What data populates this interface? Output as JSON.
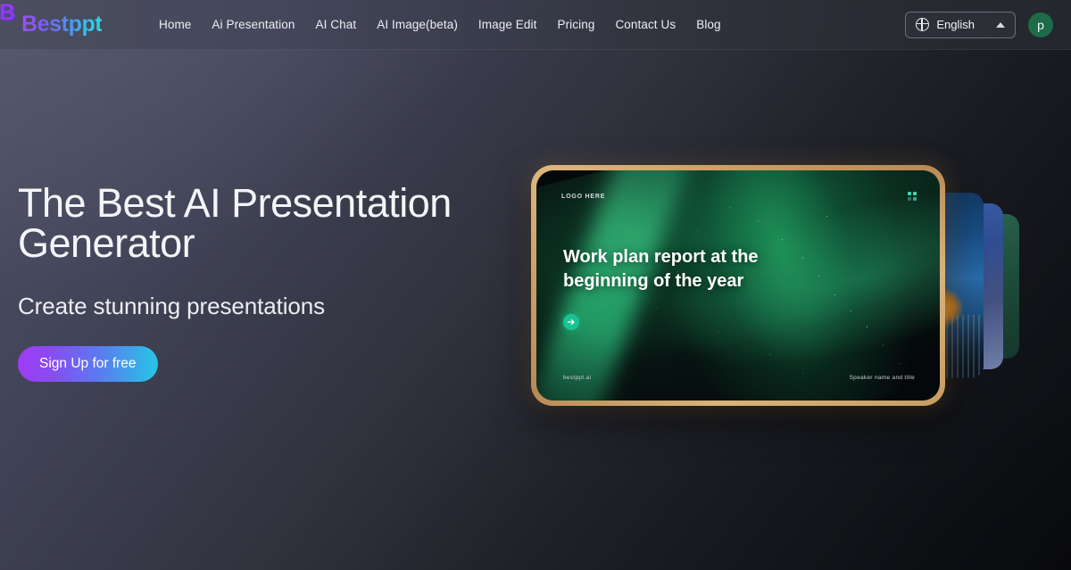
{
  "header": {
    "logo": {
      "full": "Bestppt",
      "first_letter": "B",
      "rest": "estppt"
    },
    "nav": [
      {
        "label": "Home"
      },
      {
        "label": "Ai Presentation"
      },
      {
        "label": "AI Chat"
      },
      {
        "label": "AI Image(beta)"
      },
      {
        "label": "Image Edit"
      },
      {
        "label": "Pricing"
      },
      {
        "label": "Contact Us"
      },
      {
        "label": "Blog"
      }
    ],
    "language": {
      "icon": "globe-icon",
      "value": "English",
      "chevron": "chevron-up-icon"
    },
    "avatar": {
      "initial": "p",
      "color": "#1e6b4a"
    }
  },
  "hero": {
    "title": "The Best AI Presentation\nGenerator",
    "subtitle": "Create stunning presentations",
    "cta_label": "Sign Up for free",
    "cta_gradient_from": "#a13cf5",
    "cta_gradient_to": "#2bbfe6"
  },
  "slide_preview": {
    "logo_placeholder": "LOGO HERE",
    "title": "Work plan report at the\nbeginning of the year",
    "arrow_icon": "arrow-right-icon",
    "footer_left": "bestppt.ai",
    "footer_right": "Speaker name and title",
    "frame_color": "#c99a62",
    "accent_color": "#18c293"
  },
  "stacked_cards": [
    {
      "name": "card-city",
      "color": "#1a4f86"
    },
    {
      "name": "card-blue",
      "color": "#3a5ea8"
    },
    {
      "name": "card-green",
      "color": "#2c6650"
    }
  ]
}
